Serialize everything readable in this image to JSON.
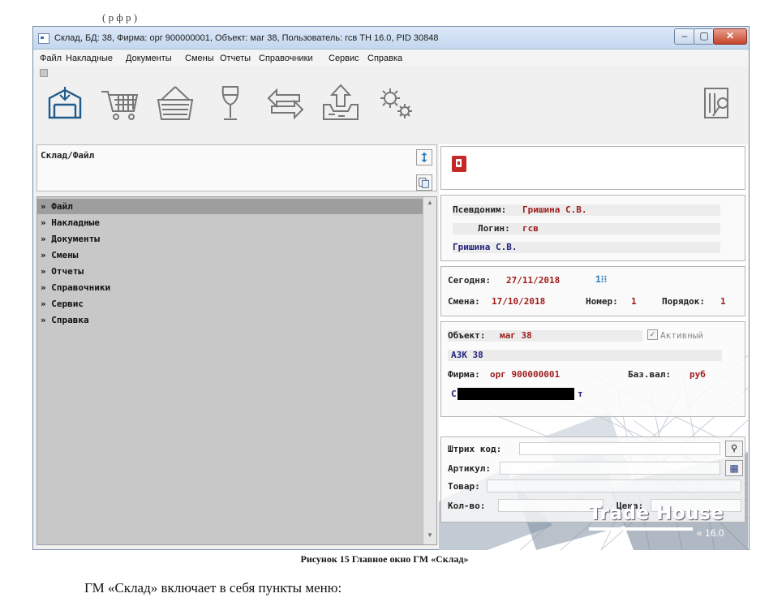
{
  "document": {
    "top_fragment": "(                                                          р    ф                      р  )",
    "caption": "Рисунок 15 Главное окно ГМ «Склад»",
    "body_text": "ГМ «Склад» включает в себя пункты меню:"
  },
  "window": {
    "title": "Склад, БД: 38, Фирма: орг 900000001, Объект: маг 38, Пользователь: гсв  TH 16.0, PID 30848",
    "controls": {
      "minimize": "–",
      "maximize": "▢",
      "close": "✕"
    }
  },
  "menubar": {
    "items": [
      "Файл",
      "Накладные",
      "Документы",
      "Смены",
      "Отчеты",
      "Справочники",
      "Сервис",
      "Справка"
    ]
  },
  "toolbar": {
    "buttons": [
      {
        "icon": "warehouse-box-icon"
      },
      {
        "icon": "shopping-cart-icon"
      },
      {
        "icon": "basket-icon"
      },
      {
        "icon": "wine-glass-icon"
      },
      {
        "icon": "exchange-arrows-icon"
      },
      {
        "icon": "upload-tray-icon"
      },
      {
        "icon": "gears-icon"
      },
      {
        "icon": "exit-icon"
      }
    ]
  },
  "path_panel": {
    "label": "Склад/Файл"
  },
  "nav": {
    "items": [
      {
        "label": "» Файл",
        "selected": true
      },
      {
        "label": "» Накладные"
      },
      {
        "label": "» Документы"
      },
      {
        "label": "» Смены"
      },
      {
        "label": "» Отчеты"
      },
      {
        "label": "» Справочники"
      },
      {
        "label": "» Сервис"
      },
      {
        "label": "» Справка"
      }
    ]
  },
  "user_box": {
    "alias_label": "Псевдоним:",
    "alias_value": "Гришина С.В.",
    "login_label": "Логин:",
    "login_value": "гсв",
    "full_name": "Гришина С.В."
  },
  "date_box": {
    "today_label": "Сегодня:",
    "today_value": "27/11/2018",
    "shift_label": "Смена:",
    "shift_value": "17/10/2018",
    "number_label": "Номер:",
    "number_value": "1",
    "order_label": "Порядок:",
    "order_value": "1"
  },
  "object_box": {
    "object_label": "Объект:",
    "object_value": "маг 38",
    "active_label": "Активный",
    "object_name": "АЗК 38",
    "firm_label": "Фирма:",
    "firm_value": "орг 900000001",
    "currency_label": "Баз.вал:",
    "currency_value": "руб",
    "firm_name_prefix": "С",
    "firm_name_suffix": "т"
  },
  "search_box": {
    "barcode_label": "Штрих код:",
    "article_label": "Артикул:",
    "product_label": "Товар:",
    "qty_label": "Кол-во:",
    "price_label": "Цена:"
  },
  "branding": {
    "logo": "Trade House",
    "version": "16.0"
  }
}
